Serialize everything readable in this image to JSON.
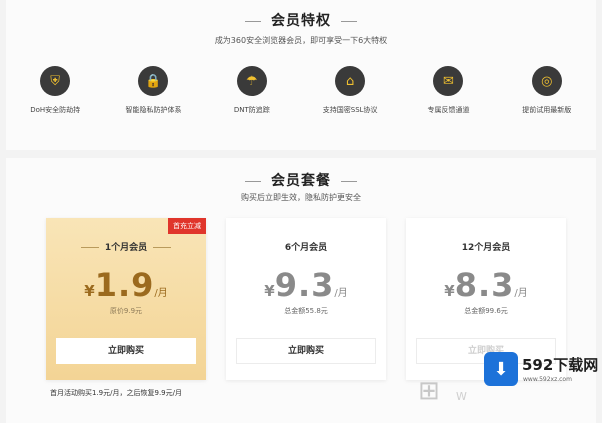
{
  "privileges": {
    "title": "会员特权",
    "subtitle": "成为360安全浏览器会员，即可享受一下6大特权",
    "items": [
      {
        "label": "DoH安全防劫持",
        "icon": "shield-icon",
        "glyph": "⛨"
      },
      {
        "label": "智能隐私防护体系",
        "icon": "lock-icon",
        "glyph": "🔒"
      },
      {
        "label": "DNT防追踪",
        "icon": "umbrella-icon",
        "glyph": "☂"
      },
      {
        "label": "支持国密SSL协议",
        "icon": "bank-icon",
        "glyph": "⌂"
      },
      {
        "label": "专属反馈通道",
        "icon": "chat-icon",
        "glyph": "✉"
      },
      {
        "label": "提前试用最新版",
        "icon": "compass-icon",
        "glyph": "◎"
      }
    ]
  },
  "packages": {
    "title": "会员套餐",
    "subtitle": "购买后立即生效，隐私防护更安全",
    "cards": [
      {
        "title": "1个月会员",
        "currency": "¥",
        "price": "1.9",
        "unit": "/月",
        "original": "原价9.9元",
        "button": "立即购买",
        "badge": "首充立减",
        "featured": true
      },
      {
        "title": "6个月会员",
        "currency": "¥",
        "price": "9.3",
        "unit": "/月",
        "original": "总金额55.8元",
        "button": "立即购买",
        "badge": "",
        "featured": false
      },
      {
        "title": "12个月会员",
        "currency": "¥",
        "price": "8.3",
        "unit": "/月",
        "original": "总金额99.6元",
        "button": "立即购买",
        "badge": "",
        "featured": false
      }
    ],
    "note": "首月活动购买1.9元/月，之后恢复9.9元/月"
  },
  "watermark": {
    "brand": "592下载网",
    "url": "www.592xz.com",
    "text": "W"
  }
}
